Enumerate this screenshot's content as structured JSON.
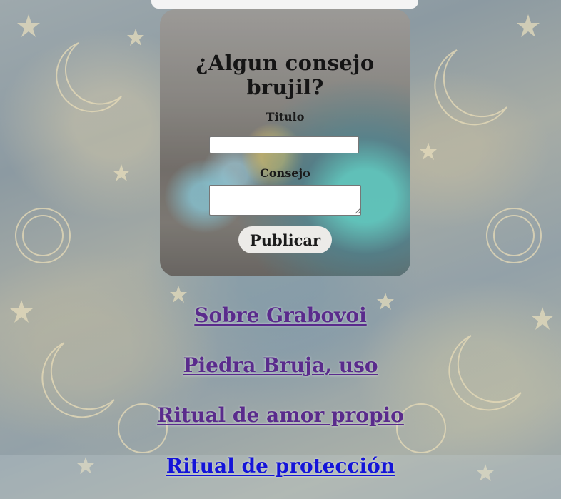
{
  "form": {
    "title": "¿Algun consejo brujil?",
    "titulo_label": "Titulo",
    "titulo_value": "",
    "consejo_label": "Consejo",
    "consejo_value": "",
    "publish_label": "Publicar"
  },
  "links": [
    {
      "label": "Sobre Grabovoi"
    },
    {
      "label": "Piedra Bruja, uso"
    },
    {
      "label": "Ritual de amor propio"
    },
    {
      "label": "Ritual de protección"
    }
  ],
  "colors": {
    "visited_link": "#5a2b8c",
    "unvisited_link": "#1414d8"
  }
}
